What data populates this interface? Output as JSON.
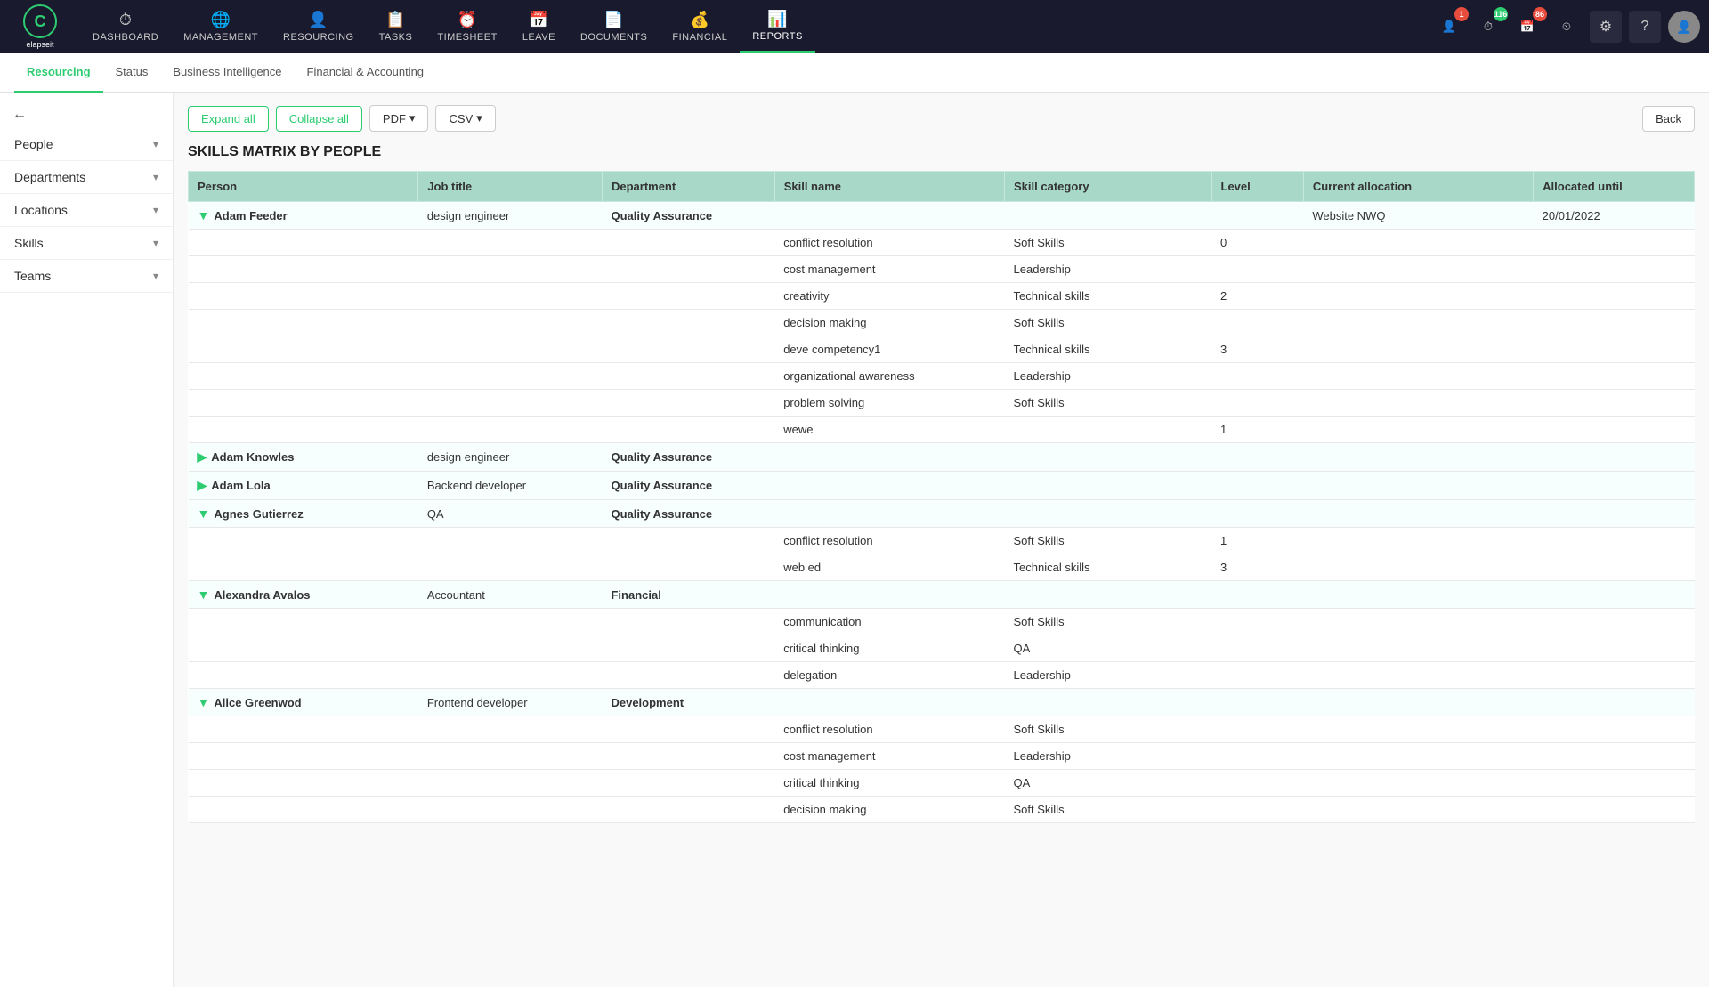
{
  "app": {
    "logo_letter": "C",
    "logo_name": "elapseit"
  },
  "topnav": {
    "items": [
      {
        "id": "dashboard",
        "label": "DASHBOARD",
        "icon": "⏱"
      },
      {
        "id": "management",
        "label": "MANAGEMENT",
        "icon": "🌐"
      },
      {
        "id": "resourcing",
        "label": "RESOURCING",
        "icon": "👤"
      },
      {
        "id": "tasks",
        "label": "TASKS",
        "icon": "📋"
      },
      {
        "id": "timesheet",
        "label": "TIMESHEET",
        "icon": "⏰"
      },
      {
        "id": "leave",
        "label": "LEAVE",
        "icon": "📅"
      },
      {
        "id": "documents",
        "label": "DOCUMENTS",
        "icon": "📄"
      },
      {
        "id": "financial",
        "label": "FINANCIAL",
        "icon": "💰"
      },
      {
        "id": "reports",
        "label": "REPORTS",
        "icon": "📊"
      }
    ],
    "badges": [
      {
        "icon": "👤",
        "count": "1",
        "color": "red"
      },
      {
        "icon": "⏱",
        "count": "116",
        "color": "green"
      },
      {
        "icon": "📅",
        "count": "86",
        "color": "red"
      }
    ]
  },
  "subnav": {
    "items": [
      {
        "id": "resourcing",
        "label": "Resourcing"
      },
      {
        "id": "status",
        "label": "Status"
      },
      {
        "id": "bi",
        "label": "Business Intelligence"
      },
      {
        "id": "financial",
        "label": "Financial & Accounting"
      }
    ],
    "active": "resourcing"
  },
  "sidebar": {
    "back_arrow": "←",
    "items": [
      {
        "id": "people",
        "label": "People"
      },
      {
        "id": "departments",
        "label": "Departments"
      },
      {
        "id": "locations",
        "label": "Locations"
      },
      {
        "id": "skills",
        "label": "Skills"
      },
      {
        "id": "teams",
        "label": "Teams"
      }
    ]
  },
  "toolbar": {
    "expand_all": "Expand all",
    "collapse_all": "Collapse all",
    "pdf": "PDF",
    "csv": "CSV",
    "back": "Back"
  },
  "page_title": "SKILLS MATRIX BY PEOPLE",
  "table": {
    "headers": [
      "Person",
      "Job title",
      "Department",
      "Skill name",
      "Skill category",
      "Level",
      "Current allocation",
      "Allocated until"
    ],
    "rows": [
      {
        "type": "person",
        "name": "Adam Feeder",
        "job": "design engineer",
        "dept": "Quality Assurance",
        "skill": "",
        "category": "",
        "level": "",
        "allocation": "Website NWQ",
        "until": "20/01/2022",
        "icon": "down"
      },
      {
        "type": "skill",
        "name": "",
        "job": "",
        "dept": "",
        "skill": "conflict resolution",
        "category": "Soft Skills",
        "level": "0",
        "allocation": "",
        "until": ""
      },
      {
        "type": "skill",
        "name": "",
        "job": "",
        "dept": "",
        "skill": "cost management",
        "category": "Leadership",
        "level": "",
        "allocation": "",
        "until": ""
      },
      {
        "type": "skill",
        "name": "",
        "job": "",
        "dept": "",
        "skill": "creativity",
        "category": "Technical skills",
        "level": "2",
        "allocation": "",
        "until": ""
      },
      {
        "type": "skill",
        "name": "",
        "job": "",
        "dept": "",
        "skill": "decision making",
        "category": "Soft Skills",
        "level": "",
        "allocation": "",
        "until": ""
      },
      {
        "type": "skill",
        "name": "",
        "job": "",
        "dept": "",
        "skill": "deve competency1",
        "category": "Technical skills",
        "level": "3",
        "allocation": "",
        "until": ""
      },
      {
        "type": "skill",
        "name": "",
        "job": "",
        "dept": "",
        "skill": "organizational awareness",
        "category": "Leadership",
        "level": "",
        "allocation": "",
        "until": ""
      },
      {
        "type": "skill",
        "name": "",
        "job": "",
        "dept": "",
        "skill": "problem solving",
        "category": "Soft Skills",
        "level": "",
        "allocation": "",
        "until": ""
      },
      {
        "type": "skill",
        "name": "",
        "job": "",
        "dept": "",
        "skill": "wewe",
        "category": "",
        "level": "1",
        "allocation": "",
        "until": ""
      },
      {
        "type": "person",
        "name": "Adam Knowles",
        "job": "design engineer",
        "dept": "Quality Assurance",
        "skill": "",
        "category": "",
        "level": "",
        "allocation": "",
        "until": "",
        "icon": "right"
      },
      {
        "type": "person",
        "name": "Adam Lola",
        "job": "Backend developer",
        "dept": "Quality Assurance",
        "skill": "",
        "category": "",
        "level": "",
        "allocation": "",
        "until": "",
        "icon": "right"
      },
      {
        "type": "person",
        "name": "Agnes Gutierrez",
        "job": "QA",
        "dept": "Quality Assurance",
        "skill": "",
        "category": "",
        "level": "",
        "allocation": "",
        "until": "",
        "icon": "down"
      },
      {
        "type": "skill",
        "name": "",
        "job": "",
        "dept": "",
        "skill": "conflict resolution",
        "category": "Soft Skills",
        "level": "1",
        "allocation": "",
        "until": ""
      },
      {
        "type": "skill",
        "name": "",
        "job": "",
        "dept": "",
        "skill": "web ed",
        "category": "Technical skills",
        "level": "3",
        "allocation": "",
        "until": ""
      },
      {
        "type": "person",
        "name": "Alexandra Avalos",
        "job": "Accountant",
        "dept": "Financial",
        "skill": "",
        "category": "",
        "level": "",
        "allocation": "",
        "until": "",
        "icon": "down"
      },
      {
        "type": "skill",
        "name": "",
        "job": "",
        "dept": "",
        "skill": "communication",
        "category": "Soft Skills",
        "level": "",
        "allocation": "",
        "until": ""
      },
      {
        "type": "skill",
        "name": "",
        "job": "",
        "dept": "",
        "skill": "critical thinking",
        "category": "QA",
        "level": "",
        "allocation": "",
        "until": ""
      },
      {
        "type": "skill",
        "name": "",
        "job": "",
        "dept": "",
        "skill": "delegation",
        "category": "Leadership",
        "level": "",
        "allocation": "",
        "until": ""
      },
      {
        "type": "person",
        "name": "Alice Greenwod",
        "job": "Frontend developer",
        "dept": "Development",
        "skill": "",
        "category": "",
        "level": "",
        "allocation": "",
        "until": "",
        "icon": "down"
      },
      {
        "type": "skill",
        "name": "",
        "job": "",
        "dept": "",
        "skill": "conflict resolution",
        "category": "Soft Skills",
        "level": "",
        "allocation": "",
        "until": ""
      },
      {
        "type": "skill",
        "name": "",
        "job": "",
        "dept": "",
        "skill": "cost management",
        "category": "Leadership",
        "level": "",
        "allocation": "",
        "until": ""
      },
      {
        "type": "skill",
        "name": "",
        "job": "",
        "dept": "",
        "skill": "critical thinking",
        "category": "QA",
        "level": "",
        "allocation": "",
        "until": ""
      },
      {
        "type": "skill",
        "name": "",
        "job": "",
        "dept": "",
        "skill": "decision making",
        "category": "Soft Skills",
        "level": "",
        "allocation": "",
        "until": ""
      }
    ]
  }
}
